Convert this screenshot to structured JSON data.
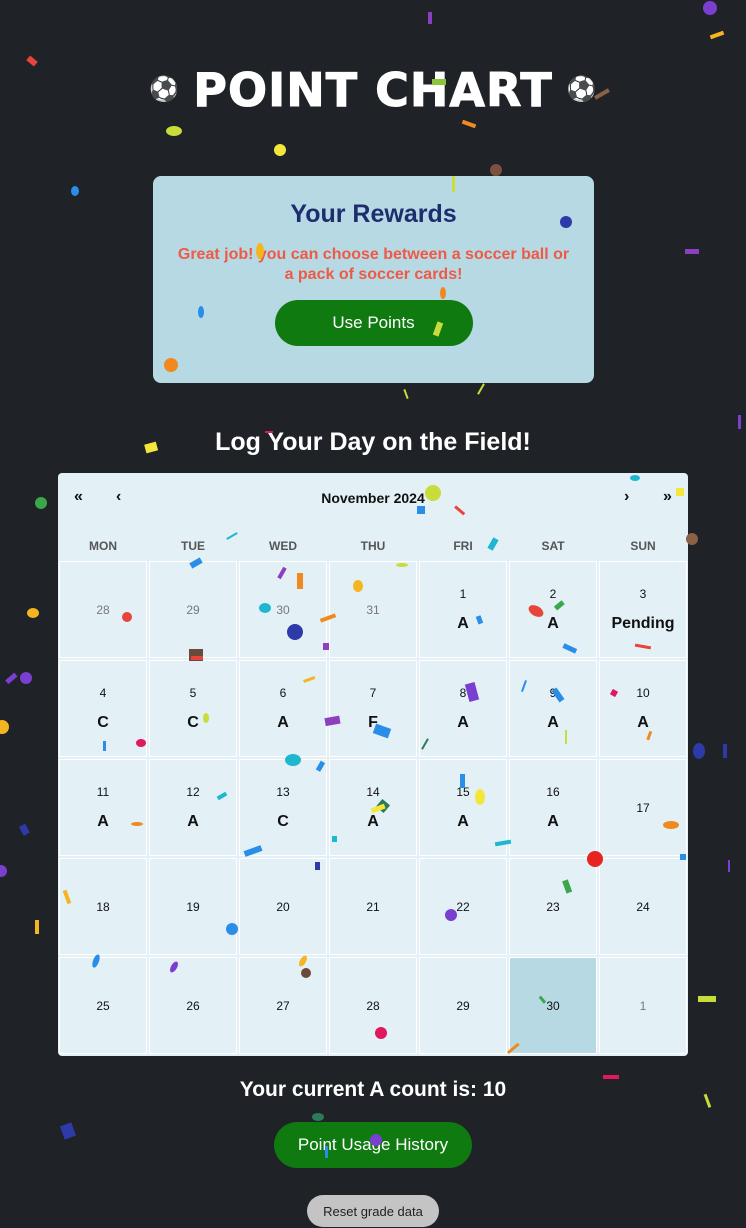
{
  "header": {
    "title": "Point Chart",
    "left_icon": "soccer-ball-icon",
    "right_icon": "soccer-ball-icon",
    "ball_glyph": "⚽"
  },
  "rewards": {
    "title": "Your Rewards",
    "message": "Great job! you can choose between a soccer ball or a pack of soccer cards!",
    "button_label": "Use Points"
  },
  "log": {
    "heading": "Log Your Day on the Field!"
  },
  "calendar": {
    "nav": {
      "prev2": "«",
      "prev": "‹",
      "label": "November 2024",
      "next": "›",
      "next2": "»"
    },
    "weekdays": [
      "MON",
      "TUE",
      "WED",
      "THU",
      "FRI",
      "SAT",
      "SUN"
    ],
    "days": [
      {
        "day": "28",
        "grade": "",
        "other": true
      },
      {
        "day": "29",
        "grade": "",
        "other": true
      },
      {
        "day": "30",
        "grade": "",
        "other": true
      },
      {
        "day": "31",
        "grade": "",
        "other": true
      },
      {
        "day": "1",
        "grade": "A"
      },
      {
        "day": "2",
        "grade": "A"
      },
      {
        "day": "3",
        "grade": "Pending"
      },
      {
        "day": "4",
        "grade": "C"
      },
      {
        "day": "5",
        "grade": "C"
      },
      {
        "day": "6",
        "grade": "A"
      },
      {
        "day": "7",
        "grade": "F"
      },
      {
        "day": "8",
        "grade": "A"
      },
      {
        "day": "9",
        "grade": "A"
      },
      {
        "day": "10",
        "grade": "A"
      },
      {
        "day": "11",
        "grade": "A"
      },
      {
        "day": "12",
        "grade": "A"
      },
      {
        "day": "13",
        "grade": "C"
      },
      {
        "day": "14",
        "grade": "A"
      },
      {
        "day": "15",
        "grade": "A"
      },
      {
        "day": "16",
        "grade": "A"
      },
      {
        "day": "17",
        "grade": ""
      },
      {
        "day": "18",
        "grade": ""
      },
      {
        "day": "19",
        "grade": ""
      },
      {
        "day": "20",
        "grade": ""
      },
      {
        "day": "21",
        "grade": ""
      },
      {
        "day": "22",
        "grade": ""
      },
      {
        "day": "23",
        "grade": ""
      },
      {
        "day": "24",
        "grade": ""
      },
      {
        "day": "25",
        "grade": ""
      },
      {
        "day": "26",
        "grade": ""
      },
      {
        "day": "27",
        "grade": ""
      },
      {
        "day": "28",
        "grade": ""
      },
      {
        "day": "29",
        "grade": ""
      },
      {
        "day": "30",
        "grade": "",
        "today": true
      },
      {
        "day": "1",
        "grade": "",
        "other": true
      }
    ]
  },
  "status": {
    "count_text": "Your current A count is: 10"
  },
  "actions": {
    "history_label": "Point Usage History",
    "reset_label": "Reset grade data"
  },
  "colors": {
    "background": "#1f2226",
    "panel": "#b6d9e4",
    "accent_green": "#0e7a10",
    "message_red": "#ee5a45",
    "title_navy": "#1d2d6e"
  }
}
